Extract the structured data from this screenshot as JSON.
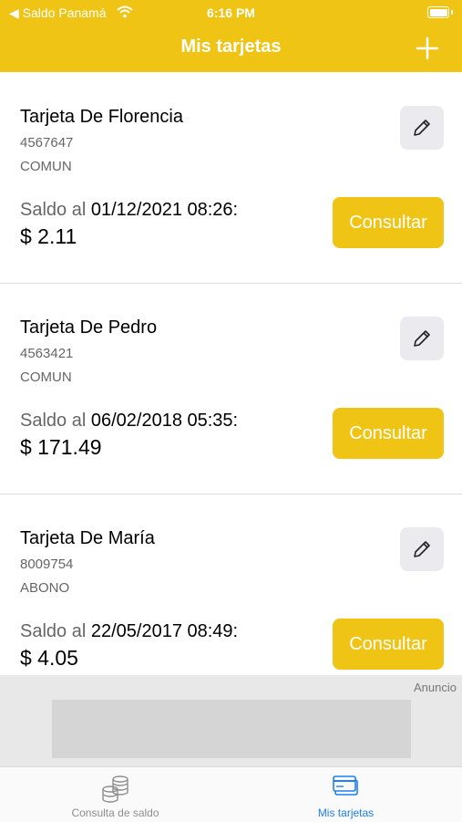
{
  "status_bar": {
    "back_label": "◀ Saldo Panamá",
    "time": "6:16 PM"
  },
  "header": {
    "title": "Mis tarjetas",
    "add_icon": "plus-icon"
  },
  "cards": [
    {
      "name": "Tarjeta De Florencia",
      "number": "4567647",
      "type": "COMUN",
      "saldo_prefix": "Saldo al",
      "saldo_date": "01/12/2021 08:26:",
      "amount": "$ 2.11",
      "button": "Consultar"
    },
    {
      "name": "Tarjeta De Pedro",
      "number": "4563421",
      "type": "COMUN",
      "saldo_prefix": "Saldo al",
      "saldo_date": "06/02/2018 05:35:",
      "amount": "$ 171.49",
      "button": "Consultar"
    },
    {
      "name": "Tarjeta De María",
      "number": "8009754",
      "type": "ABONO",
      "saldo_prefix": "Saldo al",
      "saldo_date": "22/05/2017 08:49:",
      "amount": "$ 4.05",
      "button": "Consultar"
    }
  ],
  "ad": {
    "label": "Anuncio"
  },
  "tabs": [
    {
      "label": "Consulta de saldo",
      "icon": "coins-icon",
      "active": false
    },
    {
      "label": "Mis tarjetas",
      "icon": "credit-card-icon",
      "active": true
    }
  ],
  "colors": {
    "accent": "#F0C415",
    "active_tab": "#1E7FF2",
    "inactive_tab": "#8E8E8E"
  }
}
